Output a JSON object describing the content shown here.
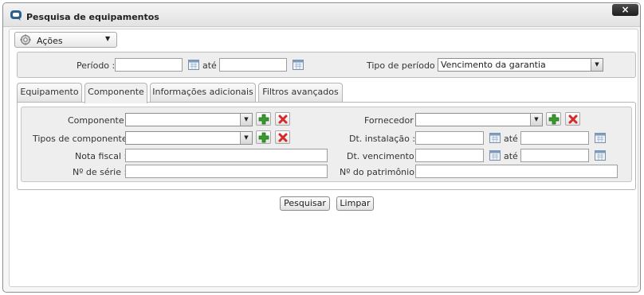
{
  "window": {
    "title": "Pesquisa de equipamentos",
    "close_label": "×"
  },
  "actions_menu": {
    "label": "Ações",
    "icon": "gear-icon"
  },
  "period": {
    "label": "Período :",
    "start_value": "",
    "separator": "até",
    "end_value": "",
    "type_label": "Tipo de período :",
    "type_selected": "Vencimento da garantia"
  },
  "tabs": [
    {
      "label": "Equipamento"
    },
    {
      "label": "Componente"
    },
    {
      "label": "Informações adicionais"
    },
    {
      "label": "Filtros avançados"
    }
  ],
  "active_tab": "Componente",
  "component_tab": {
    "componente_label": "Componente :",
    "componente_value": "",
    "tipos_label": "Tipos de componente :",
    "tipos_value": "",
    "nota_label": "Nota fiscal :",
    "nota_value": "",
    "serie_label": "Nº de série :",
    "serie_value": "",
    "fornecedor_label": "Fornecedor :",
    "fornecedor_value": "",
    "instalacao_label": "Dt. instalação :",
    "instalacao_sep": "até",
    "vencimento_label": "Dt. vencimento :",
    "vencimento_sep": "até",
    "patrimonio_label": "Nº do patrimônio :",
    "patrimonio_value": ""
  },
  "buttons": {
    "search": "Pesquisar",
    "clear": "Limpar"
  },
  "colors": {
    "add_icon": "#3a9a2e",
    "remove_icon": "#d42a2a",
    "close_button": "#2b2b2b"
  }
}
